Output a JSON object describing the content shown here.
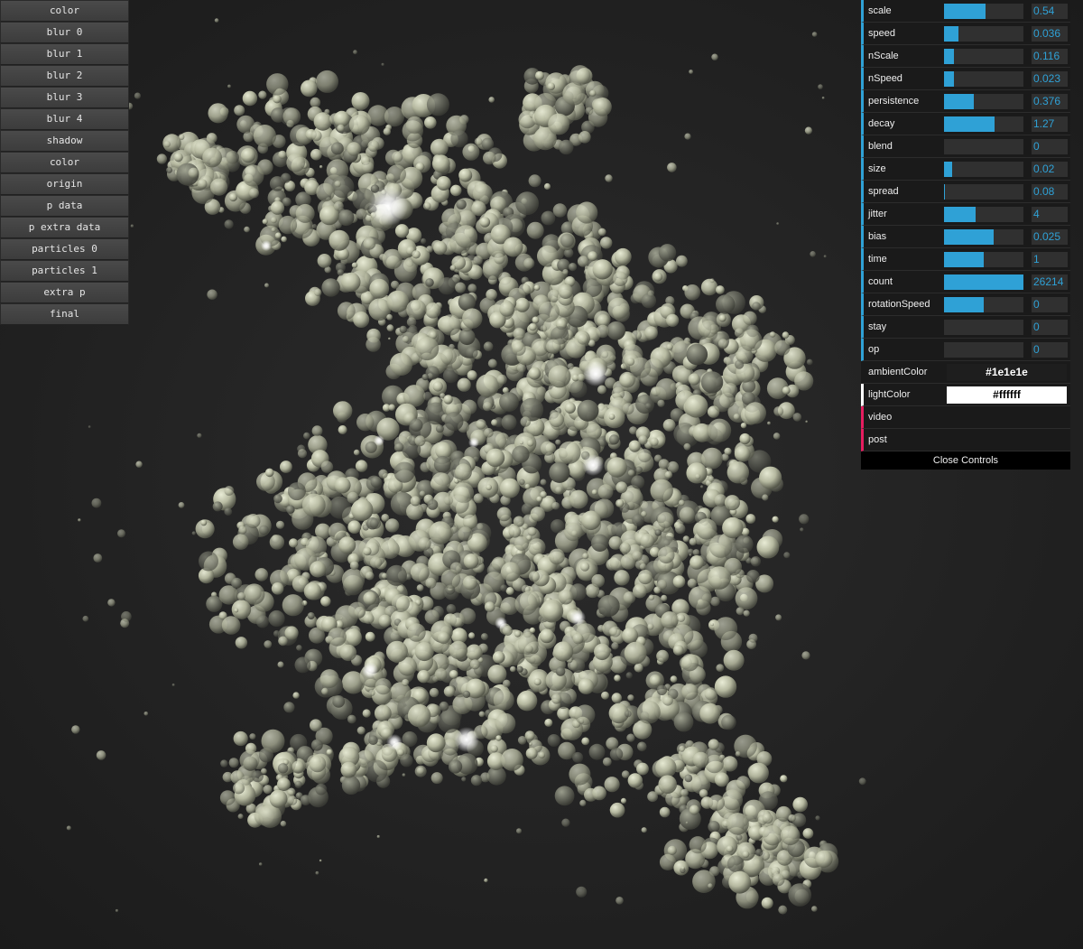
{
  "debug_buttons": [
    "color",
    "blur 0",
    "blur 1",
    "blur 2",
    "blur 3",
    "blur 4",
    "shadow",
    "color",
    "origin",
    "p data",
    "p extra data",
    "particles 0",
    "particles 1",
    "extra p",
    "final"
  ],
  "controls": [
    {
      "label": "scale",
      "value": "0.54",
      "fill": 0.52
    },
    {
      "label": "speed",
      "value": "0.036",
      "fill": 0.18
    },
    {
      "label": "nScale",
      "value": "0.116",
      "fill": 0.12
    },
    {
      "label": "nSpeed",
      "value": "0.023",
      "fill": 0.12
    },
    {
      "label": "persistence",
      "value": "0.376",
      "fill": 0.38
    },
    {
      "label": "decay",
      "value": "1.27",
      "fill": 0.64
    },
    {
      "label": "blend",
      "value": "0",
      "fill": 0
    },
    {
      "label": "size",
      "value": "0.02",
      "fill": 0.1
    },
    {
      "label": "spread",
      "value": "0.08",
      "fill": 0.01
    },
    {
      "label": "jitter",
      "value": "4",
      "fill": 0.4
    },
    {
      "label": "bias",
      "value": "0.025",
      "fill": 0.62
    },
    {
      "label": "time",
      "value": "1",
      "fill": 0.5
    },
    {
      "label": "count",
      "value": "26214",
      "fill": 1.0
    },
    {
      "label": "rotationSpeed",
      "value": "0",
      "fill": 0.5
    },
    {
      "label": "stay",
      "value": "0",
      "fill": 0
    },
    {
      "label": "op",
      "value": "0",
      "fill": 0
    }
  ],
  "ambient": {
    "label": "ambientColor",
    "value": "#1e1e1e",
    "color": "#1e1e1e",
    "text_color": "#ffffff"
  },
  "light": {
    "label": "lightColor",
    "value": "#ffffff",
    "color": "#ffffff",
    "text_color": "#000000"
  },
  "folders": [
    "video",
    "post"
  ],
  "close_label": "Close Controls",
  "accent_color": "#2fa1d6",
  "folder_color": "#e61d5f"
}
